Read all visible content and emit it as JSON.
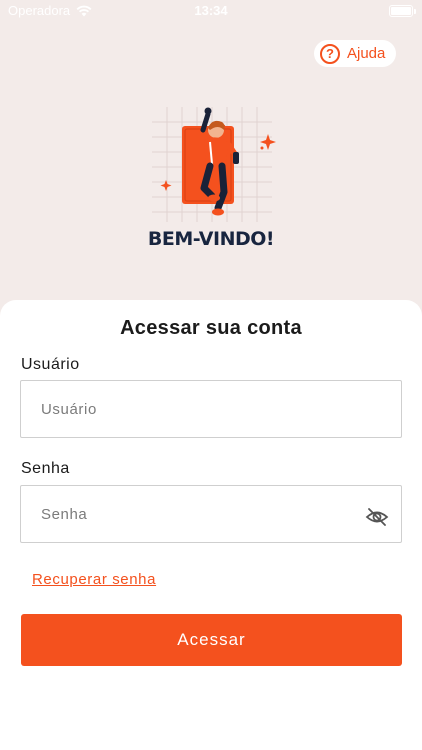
{
  "status_bar": {
    "carrier": "Operadora",
    "time": "13:34",
    "battery_level": 1.0
  },
  "help": {
    "icon_glyph": "?",
    "label": "Ajuda"
  },
  "hero": {
    "welcome_text": "BEM-VINDO!"
  },
  "login": {
    "title": "Acessar sua conta",
    "username": {
      "label": "Usuário",
      "placeholder": "Usuário",
      "value": ""
    },
    "password": {
      "label": "Senha",
      "placeholder": "Senha",
      "value": "",
      "toggle_icon": "eye-off-icon"
    },
    "recover_label": "Recuperar senha",
    "submit_label": "Acessar"
  },
  "colors": {
    "accent": "#f4511e",
    "navy": "#18253f",
    "background": "#f3ebe9",
    "card": "#ffffff"
  }
}
